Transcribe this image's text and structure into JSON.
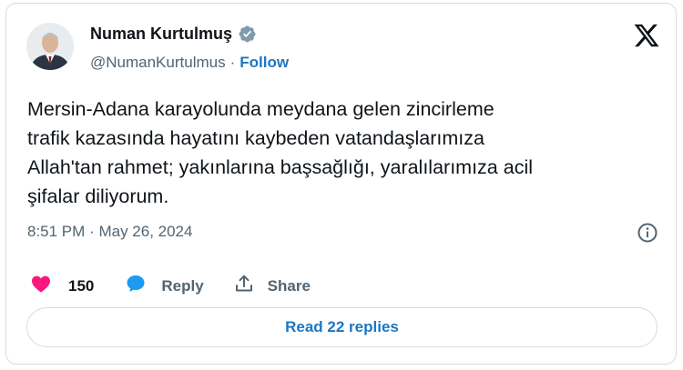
{
  "author": {
    "name": "Numan Kurtulmuş",
    "handle": "@NumanKurtulmus",
    "separator": "·",
    "follow_label": "Follow"
  },
  "tweet": {
    "line1": "Mersin-Adana karayolunda meydana gelen zincirleme",
    "line2": "trafik kazasında hayatını kaybeden vatandaşlarımıza",
    "line3": "Allah'tan rahmet; yakınlarına başsağlığı, yaralılarımıza acil",
    "line4": "şifalar diliyorum.",
    "time": "8:51 PM",
    "separator": "·",
    "date": "May 26, 2024"
  },
  "actions": {
    "like_count": "150",
    "reply_label": "Reply",
    "share_label": "Share"
  },
  "read_replies_label": "Read 22 replies",
  "icons": [
    "verified-badge-icon",
    "x-logo-icon",
    "info-icon",
    "heart-icon",
    "reply-bubble-icon",
    "share-icon"
  ],
  "colors": {
    "link": "#1d76c2",
    "heart": "#f91880",
    "verified_badge": "#829aab",
    "text": "#0f1419",
    "secondary_text": "#536471",
    "border": "#d6dbe0"
  }
}
